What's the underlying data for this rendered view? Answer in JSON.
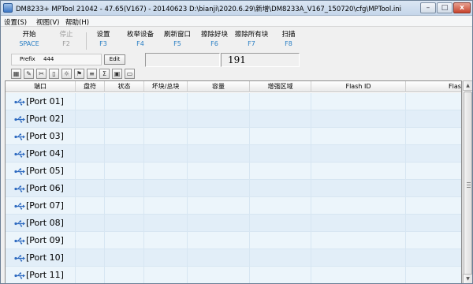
{
  "title": "DM8233+ MPTool 21042 - 47.65(V167) - 20140623  D:\\bianji\\2020.6.29\\新增\\DM8233A_V167_150720\\cfg\\MPTool.ini",
  "window_controls": {
    "minimize": "–",
    "maximize": "□",
    "close": "x"
  },
  "menu": [
    "设置(S)",
    "视图(V)",
    "帮助(H)"
  ],
  "function_bar": [
    {
      "label": "开始",
      "key": "SPACE",
      "enabled": true
    },
    {
      "label": "停止",
      "key": "F2",
      "enabled": false
    },
    {
      "label": "设置",
      "key": "F3",
      "enabled": true
    },
    {
      "label": "枚举设备",
      "key": "F4",
      "enabled": true
    },
    {
      "label": "刷新窗口",
      "key": "F5",
      "enabled": true
    },
    {
      "label": "擦除好块",
      "key": "F6",
      "enabled": true
    },
    {
      "label": "擦除所有块",
      "key": "F7",
      "enabled": true
    },
    {
      "label": "扫描",
      "key": "F8",
      "enabled": true
    }
  ],
  "prefix": {
    "label": "Prefix",
    "value": "444",
    "edit_button": "Edit"
  },
  "counter": "191",
  "icon_toolbar": [
    {
      "icon": "grid-icon",
      "glyph": "▦"
    },
    {
      "icon": "pin-icon",
      "glyph": "✎"
    },
    {
      "icon": "tool-icon",
      "glyph": "✂"
    },
    {
      "icon": "page-icon",
      "glyph": "▯"
    },
    {
      "icon": "bulb-icon",
      "glyph": "☼"
    },
    {
      "icon": "flag-icon",
      "glyph": "⚑"
    },
    {
      "icon": "list-icon",
      "glyph": "≡"
    },
    {
      "icon": "sum-icon",
      "glyph": "Σ"
    },
    {
      "icon": "window-icon",
      "glyph": "▣"
    },
    {
      "icon": "monitor-icon",
      "glyph": "▭"
    }
  ],
  "table": {
    "columns": [
      "端口",
      "盘符",
      "状态",
      "坏块/总块",
      "容量",
      "增强区域",
      "Flash ID",
      "Flash"
    ],
    "rows": [
      "[Port 01]",
      "[Port 02]",
      "[Port 03]",
      "[Port 04]",
      "[Port 05]",
      "[Port 06]",
      "[Port 07]",
      "[Port 08]",
      "[Port 09]",
      "[Port 10]",
      "[Port 11]"
    ]
  },
  "colors": {
    "row_odd": "#ecf5fb",
    "row_even": "#e2eef8",
    "key_blue": "#2a7fc4",
    "usb_blue": "#2f6bc0"
  },
  "scrollbar": {
    "up": "▲",
    "down": "▼"
  }
}
